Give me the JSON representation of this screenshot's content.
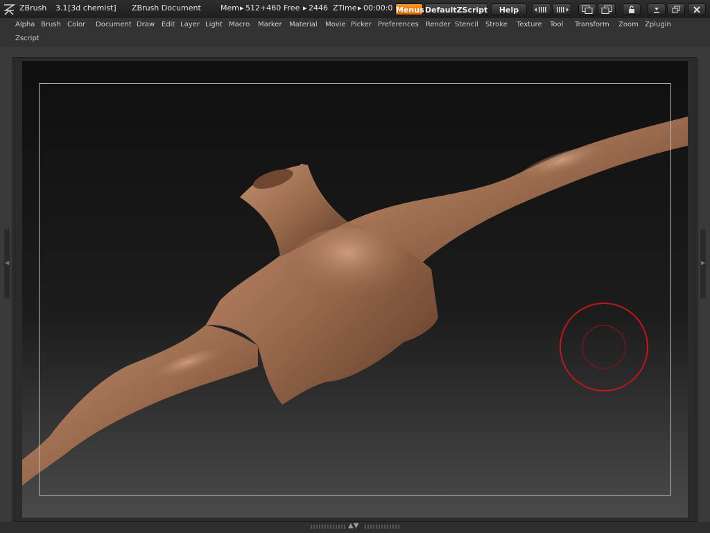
{
  "titlebar": {
    "app_name": "ZBrush",
    "version": "3.1",
    "user": "[3d chemist]",
    "document": "ZBrush Document",
    "mem_label": "Mem",
    "mem_value": "512+460",
    "free_label": "Free",
    "free_value": "2446",
    "ztime_label": "ZTime",
    "ztime_value": "00:00:0",
    "menus_label": "Menus",
    "script_label": "DefaultZScript",
    "help_label": "Help"
  },
  "menubar": {
    "items": [
      "Alpha",
      "Brush",
      "Color",
      "Document",
      "Draw",
      "Edit",
      "Layer",
      "Light",
      "Macro",
      "Marker",
      "Material",
      "Movie",
      "Picker",
      "Preferences",
      "Render",
      "Stencil",
      "Stroke",
      "Texture",
      "Tool",
      "Transform",
      "Zoom",
      "Zplugin",
      "Zscript"
    ]
  },
  "colors": {
    "accent": "#e4760f",
    "brush_cursor": "#c01818",
    "model_skin": "#9a6a4d"
  }
}
